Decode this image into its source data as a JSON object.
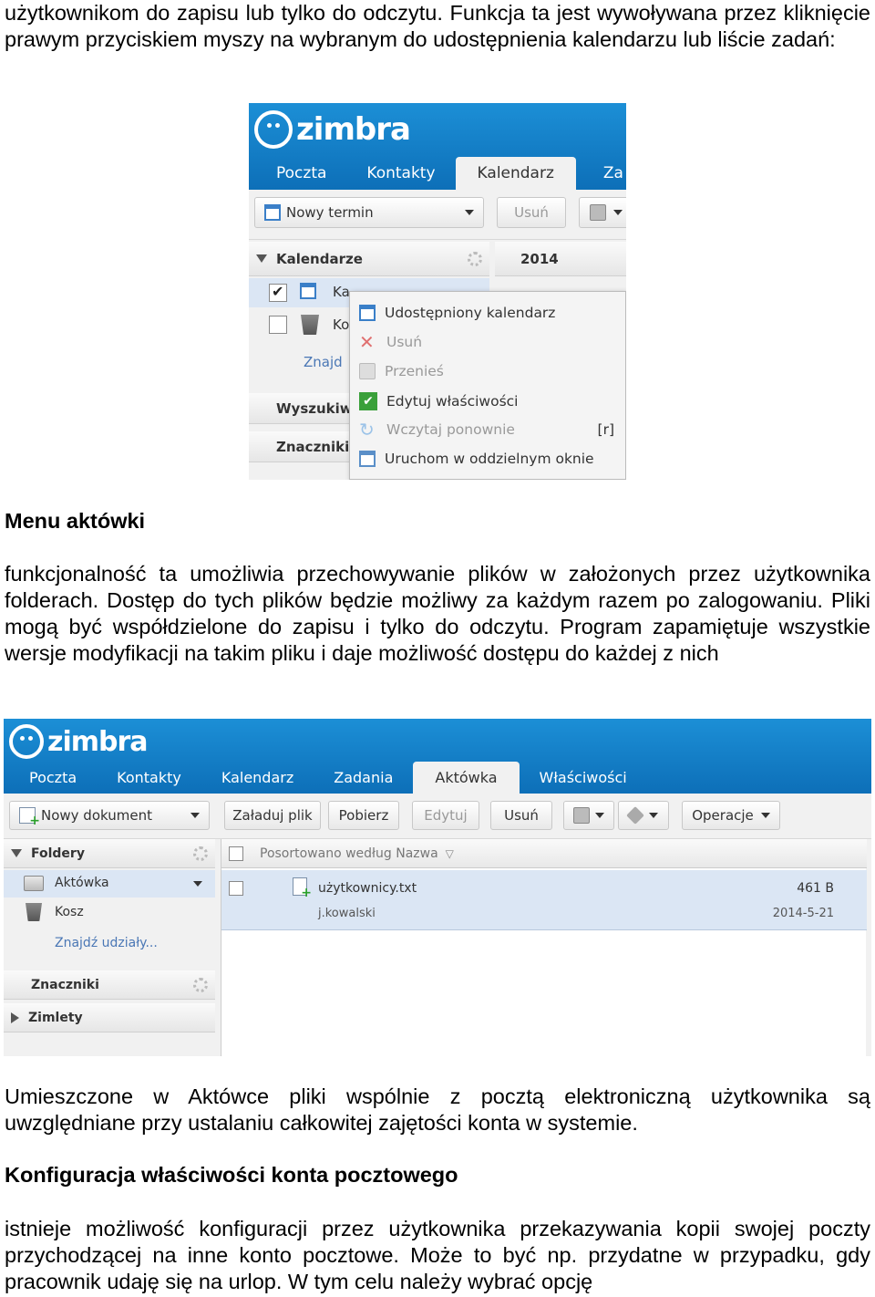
{
  "doc": {
    "para1": "użytkownikom do zapisu lub tylko do odczytu. Funkcja ta jest wywoływana przez kliknięcie prawym przyciskiem myszy na wybranym do udostępnienia kalendarzu lub liście zadań:",
    "heading1": "Menu aktówki",
    "para2": "funkcjonalność ta umożliwia przechowywanie plików w założonych przez użytkownika folderach. Dostęp do tych plików będzie możliwy za każdym razem po zalogowaniu. Pliki mogą być współdzielone do zapisu i tylko do odczytu. Program zapamiętuje wszystkie wersje modyfikacji na takim pliku i daje możliwość dostępu do każdej z nich",
    "para3": "Umieszczone w Aktówce pliki wspólnie z pocztą elektroniczną użytkownika są uwzględniane przy ustalaniu całkowitej zajętości konta w systemie.",
    "heading2": "Konfiguracja właściwości konta pocztowego",
    "para4": "istnieje możliwość konfiguracji przez użytkownika przekazywania kopii swojej poczty przychodzącej na inne konto pocztowe. Może to być np. przydatne w przypadku, gdy pracownik udaję się na urlop. W tym celu należy wybrać opcję"
  },
  "shot1": {
    "logo": "zimbra",
    "tabs": [
      "Poczta",
      "Kontakty",
      "Kalendarz",
      "Za"
    ],
    "active_tab": "Kalendarz",
    "toolbar": {
      "new": "Nowy termin",
      "delete": "Usuń"
    },
    "panel_title": "Kalendarze",
    "year": "2014",
    "items": [
      "Ka",
      "Ko"
    ],
    "find": "Znajd",
    "sections": [
      "Wyszukiw",
      "Znaczniki"
    ],
    "menu": [
      {
        "label": "Udostępniony kalendarz",
        "icon": "calendar-icon",
        "enabled": true
      },
      {
        "label": "Usuń",
        "icon": "delete-x-icon",
        "enabled": false
      },
      {
        "label": "Przenieś",
        "icon": "move-icon",
        "enabled": false
      },
      {
        "label": "Edytuj właściwości",
        "icon": "edit-properties-icon",
        "enabled": true
      },
      {
        "label": "Wczytaj ponownie",
        "icon": "reload-icon",
        "enabled": false,
        "shortcut": "[r]"
      },
      {
        "label": "Uruchom w oddzielnym oknie",
        "icon": "new-window-icon",
        "enabled": true
      }
    ]
  },
  "shot2": {
    "logo": "zimbra",
    "tabs": [
      "Poczta",
      "Kontakty",
      "Kalendarz",
      "Zadania",
      "Aktówka",
      "Właściwości"
    ],
    "active_tab": "Aktówka",
    "toolbar": {
      "new_doc": "Nowy dokument",
      "upload": "Załaduj plik",
      "download": "Pobierz",
      "edit": "Edytuj",
      "delete": "Usuń",
      "operations": "Operacje"
    },
    "folders_title": "Foldery",
    "folders": [
      "Aktówka",
      "Kosz"
    ],
    "find_shares": "Znajdź udziały...",
    "tags_title": "Znaczniki",
    "zimlets_title": "Zimlety",
    "sort_label": "Posortowano według Nazwa",
    "file": {
      "name": "użytkownicy.txt",
      "size": "461 B",
      "owner": "j.kowalski",
      "date": "2014-5-21"
    }
  }
}
